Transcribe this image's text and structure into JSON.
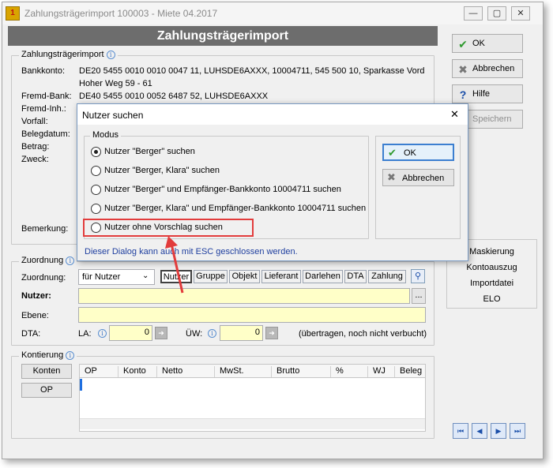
{
  "window": {
    "title": "Zahlungsträgerimport 100003 - Miete 04.2017",
    "logo_text": "1",
    "minimize": "—",
    "maximize": "▢",
    "close": "✕"
  },
  "header": {
    "title": "Zahlungsträgerimport"
  },
  "import_group": {
    "legend": "Zahlungsträgerimport",
    "fields": [
      {
        "label": "Bankkonto:",
        "value": "DE20 5455 0010 0010 0047 11,  LUHSDE6AXXX,  10004711,  545 500 10,  Sparkasse Vord"
      },
      {
        "label": "",
        "value": "Hoher Weg 59 - 61"
      },
      {
        "label": "Fremd-Bank:",
        "value": "DE40 5455 0010 0052 6487 52,  LUHSDE6AXXX"
      },
      {
        "label": "Fremd-Inh.:",
        "value": ""
      },
      {
        "label": "Vorfall:",
        "value": ""
      },
      {
        "label": "Belegdatum:",
        "value": ""
      },
      {
        "label": "Betrag:",
        "value": ""
      },
      {
        "label": "Zweck:",
        "value": ""
      }
    ],
    "remark_label": "Bemerkung:"
  },
  "assignment_group": {
    "legend": "Zuordnung",
    "assignment_label": "Zuordnung:",
    "assignment_value": "für Nutzer",
    "tabs": [
      "Nutzer",
      "Gruppe",
      "Objekt",
      "Lieferant",
      "Darlehen",
      "DTA",
      "Zahlung"
    ],
    "user_label": "Nutzer:",
    "user_browse": "...",
    "level_label": "Ebene:",
    "dta_label": "DTA:",
    "la_label": "LA:",
    "la_value": "0",
    "uew_label": "ÜW:",
    "uew_value": "0",
    "status_text": "(übertragen, noch nicht verbucht)"
  },
  "posting_group": {
    "legend": "Kontierung",
    "accounts_button": "Konten",
    "op_button": "OP",
    "columns": [
      "OP",
      "Konto",
      "Netto",
      "MwSt.",
      "Brutto",
      "%",
      "WJ",
      "Beleg"
    ]
  },
  "side": {
    "ok": "OK",
    "cancel": "Abbrechen",
    "help": "Hilfe",
    "save": "Speichern",
    "links": [
      "Maskierung",
      "Kontoauszug",
      "Importdatei",
      "ELO"
    ]
  },
  "nav": {
    "first": "⏮",
    "prev": "◀",
    "next": "▶",
    "last": "⏭"
  },
  "dialog": {
    "title": "Nutzer suchen",
    "close": "✕",
    "group_legend": "Modus",
    "options": [
      "Nutzer \"Berger\" suchen",
      "Nutzer \"Berger, Klara\" suchen",
      "Nutzer \"Berger\" und Empfänger-Bankkonto 10004711 suchen",
      "Nutzer \"Berger, Klara\" und Empfänger-Bankkonto 10004711 suchen",
      "Nutzer ohne Vorschlag suchen"
    ],
    "selected_index": 0,
    "ok": "OK",
    "cancel": "Abbrechen",
    "hint": "Dieser Dialog kann auch mit ESC geschlossen werden."
  },
  "colors": {
    "header_bg": "#6d6d6d",
    "input_yellow": "#ffffc8",
    "highlight_red": "#e23c3c",
    "hint_blue": "#1f3f9f"
  }
}
